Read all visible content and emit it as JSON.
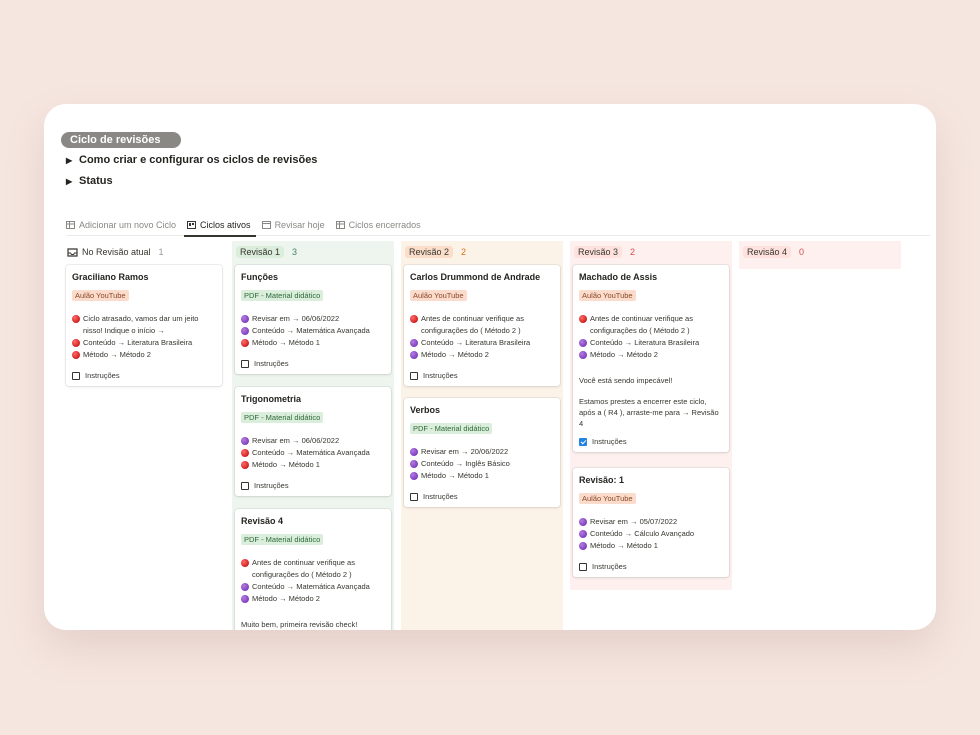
{
  "section_title": "Ciclo de revisões",
  "toggles": [
    {
      "label": "Como criar e configurar os ciclos de revisões"
    },
    {
      "label": "Status"
    }
  ],
  "tabs": [
    {
      "label": "Adicionar um novo Ciclo",
      "icon": "table-icon",
      "active": false
    },
    {
      "label": "Ciclos ativos",
      "icon": "board-icon",
      "active": true
    },
    {
      "label": "Revisar hoje",
      "icon": "calendar-icon",
      "active": false
    },
    {
      "label": "Ciclos encerrados",
      "icon": "table-icon",
      "active": false
    }
  ],
  "colors": {
    "background": "#f6e6e0",
    "gray_column": "#f7f6f3",
    "green_column": "#eef5ef",
    "orange_column": "#fcf3e8",
    "red_column": "#fdf0ee",
    "green_pill": "#dbeddb",
    "orange_pill": "#fadec9",
    "red_pill": "#ffe2dd"
  },
  "columns": [
    {
      "title": "No Revisão atual",
      "count": "1",
      "icon": "inbox-icon",
      "cards": [
        {
          "title": "Graciliano Ramos",
          "tag": "Aulão YouTube",
          "lines": [
            {
              "dot": "red",
              "text": "Ciclo atrasado, vamos dar um jeito nisso! Indique o início →"
            },
            {
              "dot": "red",
              "text": "Conteúdo → Literatura Brasileira"
            },
            {
              "dot": "red",
              "text": "Método → Método 2"
            }
          ],
          "checkbox": "Instruções",
          "checked": false
        }
      ]
    },
    {
      "title": "Revisão 1",
      "count": "3",
      "cards": [
        {
          "title": "Funções",
          "tag": "PDF - Material didático",
          "lines": [
            {
              "dot": "purple",
              "text": "Revisar em → 06/06/2022"
            },
            {
              "dot": "purple",
              "text": "Conteúdo → Matemática Avançada"
            },
            {
              "dot": "red",
              "text": "Método → Método 1"
            }
          ],
          "checkbox": "Instruções",
          "checked": false
        },
        {
          "title": "Trigonometria",
          "tag": "PDF - Material didático",
          "lines": [
            {
              "dot": "purple",
              "text": "Revisar em → 06/06/2022"
            },
            {
              "dot": "red",
              "text": "Conteúdo → Matemática Avançada"
            },
            {
              "dot": "red",
              "text": "Método → Método 1"
            }
          ],
          "checkbox": "Instruções",
          "checked": false
        },
        {
          "title": "Revisão 4",
          "tag": "PDF - Material didático",
          "lines": [
            {
              "dot": "red",
              "text": "Antes de continuar verifique as configurações do ( Método 2 )"
            },
            {
              "dot": "purple",
              "text": "Conteúdo → Matemática Avançada"
            },
            {
              "dot": "purple",
              "text": "Método → Método 2"
            }
          ],
          "paragraph": "Muito bem, primeira revisão check!"
        }
      ]
    },
    {
      "title": "Revisão 2",
      "count": "2",
      "cards": [
        {
          "title": "Carlos Drummond de Andrade",
          "tag": "Aulão YouTube",
          "lines": [
            {
              "dot": "red",
              "text": "Antes de continuar verifique as configurações do ( Método 2 )"
            },
            {
              "dot": "purple",
              "text": "Conteúdo → Literatura Brasileira"
            },
            {
              "dot": "purple",
              "text": "Método → Método 2"
            }
          ],
          "checkbox": "Instruções",
          "checked": false
        },
        {
          "title": "Verbos",
          "tag": "PDF - Material didático",
          "lines": [
            {
              "dot": "purple",
              "text": "Revisar em → 20/06/2022"
            },
            {
              "dot": "purple",
              "text": "Conteúdo → Inglês Básico"
            },
            {
              "dot": "purple",
              "text": "Método → Método 1"
            }
          ],
          "checkbox": "Instruções",
          "checked": false
        }
      ]
    },
    {
      "title": "Revisão 3",
      "count": "2",
      "cards": [
        {
          "title": "Machado de Assis",
          "tag": "Aulão YouTube",
          "lines": [
            {
              "dot": "red",
              "text": "Antes de continuar verifique as configurações do ( Método 2 )"
            },
            {
              "dot": "purple",
              "text": "Conteúdo → Literatura Brasileira"
            },
            {
              "dot": "purple",
              "text": "Método → Método 2"
            }
          ],
          "paragraph": "Você está sendo impecável!",
          "paragraph2": "Estamos prestes a encerrer este ciclo, após a ( R4 ), arraste-me para → Revisão 4",
          "checkbox": "Instruções",
          "checked": true
        },
        {
          "title": "Revisão: 1",
          "tag": "Aulão YouTube",
          "lines": [
            {
              "dot": "purple",
              "text": "Revisar em → 05/07/2022"
            },
            {
              "dot": "purple",
              "text": "Conteúdo → Cálculo Avançado"
            },
            {
              "dot": "purple",
              "text": "Método → Método 1"
            }
          ],
          "checkbox": "Instruções",
          "checked": false
        }
      ]
    },
    {
      "title": "Revisão 4",
      "count": "0",
      "cards": []
    }
  ]
}
